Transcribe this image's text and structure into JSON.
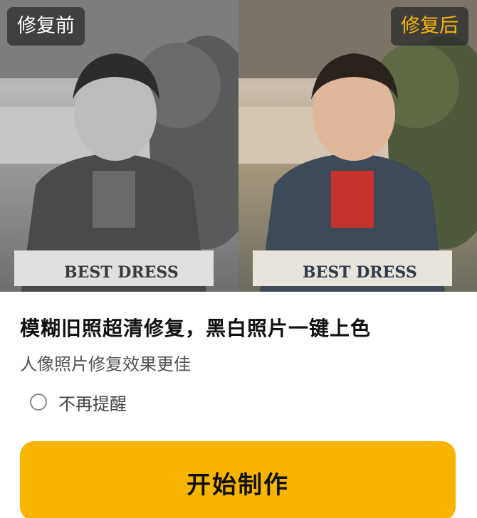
{
  "compare": {
    "before_label": "修复前",
    "after_label": "修复后",
    "shirt_text": "BEST DRESS"
  },
  "headline": "模糊旧照超清修复，黑白照片一键上色",
  "subtext": "人像照片修复效果更佳",
  "remind": {
    "label": "不再提醒",
    "checked": false
  },
  "start_button_label": "开始制作",
  "colors": {
    "accent": "#f7b500",
    "after_tag_text": "#f7b500",
    "tag_bg": "rgba(40,40,40,0.72)"
  }
}
